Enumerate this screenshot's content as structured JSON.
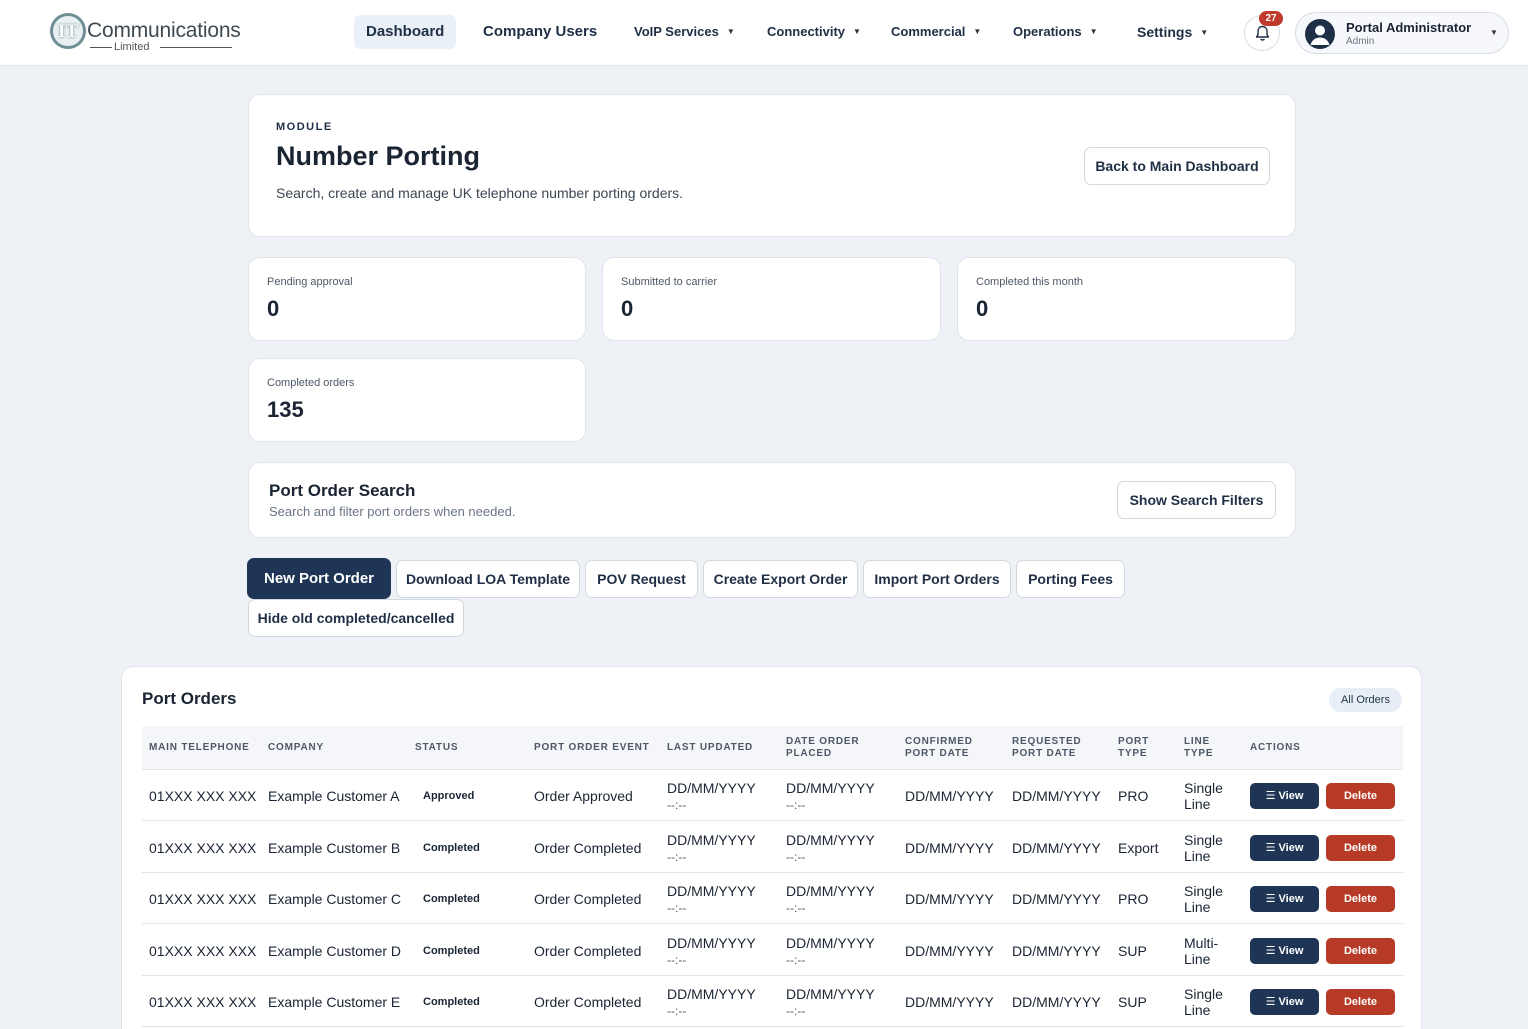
{
  "brand": {
    "name": "Communications",
    "sub": "Limited",
    "initials": "IT"
  },
  "nav": {
    "dashboard": "Dashboard",
    "company_users": "Company Users",
    "voip": "VoIP Services",
    "connectivity": "Connectivity",
    "commercial": "Commercial",
    "operations": "Operations",
    "settings": "Settings"
  },
  "notifications": {
    "count": "27"
  },
  "user": {
    "name": "Portal Administrator",
    "role": "Admin"
  },
  "module": {
    "label": "MODULE",
    "title": "Number Porting",
    "description": "Search, create and manage UK telephone number porting orders.",
    "back_button": "Back to Main Dashboard"
  },
  "stats": [
    {
      "label": "Pending approval",
      "value": "0"
    },
    {
      "label": "Submitted to carrier",
      "value": "0"
    },
    {
      "label": "Completed this month",
      "value": "0"
    },
    {
      "label": "Completed orders",
      "value": "135"
    }
  ],
  "search": {
    "title": "Port Order Search",
    "subtitle": "Search and filter port orders when needed.",
    "toggle_button": "Show Search Filters"
  },
  "actions": {
    "new_port_order": "New Port Order",
    "download_loa": "Download LOA Template",
    "pov_request": "POV Request",
    "create_export": "Create Export Order",
    "import_orders": "Import Port Orders",
    "porting_fees": "Porting Fees",
    "hide_old": "Hide old completed/cancelled"
  },
  "orders": {
    "title": "Port Orders",
    "filter_pill": "All Orders",
    "columns": {
      "main_telephone": "MAIN TELEPHONE",
      "company": "COMPANY",
      "status": "STATUS",
      "event": "PORT ORDER EVENT",
      "last_updated": "LAST UPDATED",
      "date_placed_1": "DATE ORDER",
      "date_placed_2": "PLACED",
      "confirmed_1": "CONFIRMED",
      "confirmed_2": "PORT DATE",
      "requested_1": "REQUESTED",
      "requested_2": "PORT DATE",
      "port_type_1": "PORT",
      "port_type_2": "TYPE",
      "line_type_1": "LINE",
      "line_type_2": "TYPE",
      "actions": "ACTIONS"
    },
    "view_label": "View",
    "delete_label": "Delete",
    "rows": [
      {
        "phone": "01XXX XXX XXX",
        "company": "Example Customer A",
        "status": "Approved",
        "event": "Order Approved",
        "updated_date": "DD/MM/YYYY",
        "updated_time": "--:--",
        "placed_date": "DD/MM/YYYY",
        "placed_time": "--:--",
        "confirmed": "DD/MM/YYYY",
        "requested": "DD/MM/YYYY",
        "port_type": "PRO",
        "line_1": "Single",
        "line_2": "Line"
      },
      {
        "phone": "01XXX XXX XXX",
        "company": "Example Customer B",
        "status": "Completed",
        "event": "Order Completed",
        "updated_date": "DD/MM/YYYY",
        "updated_time": "--:--",
        "placed_date": "DD/MM/YYYY",
        "placed_time": "--:--",
        "confirmed": "DD/MM/YYYY",
        "requested": "DD/MM/YYYY",
        "port_type": "Export",
        "line_1": "Single",
        "line_2": "Line"
      },
      {
        "phone": "01XXX XXX XXX",
        "company": "Example Customer C",
        "status": "Completed",
        "event": "Order Completed",
        "updated_date": "DD/MM/YYYY",
        "updated_time": "--:--",
        "placed_date": "DD/MM/YYYY",
        "placed_time": "--:--",
        "confirmed": "DD/MM/YYYY",
        "requested": "DD/MM/YYYY",
        "port_type": "PRO",
        "line_1": "Single",
        "line_2": "Line"
      },
      {
        "phone": "01XXX XXX XXX",
        "company": "Example Customer D",
        "status": "Completed",
        "event": "Order Completed",
        "updated_date": "DD/MM/YYYY",
        "updated_time": "--:--",
        "placed_date": "DD/MM/YYYY",
        "placed_time": "--:--",
        "confirmed": "DD/MM/YYYY",
        "requested": "DD/MM/YYYY",
        "port_type": "SUP",
        "line_1": "Multi-",
        "line_2": "Line"
      },
      {
        "phone": "01XXX XXX XXX",
        "company": "Example Customer E",
        "status": "Completed",
        "event": "Order Completed",
        "updated_date": "DD/MM/YYYY",
        "updated_time": "--:--",
        "placed_date": "DD/MM/YYYY",
        "placed_time": "--:--",
        "confirmed": "DD/MM/YYYY",
        "requested": "DD/MM/YYYY",
        "port_type": "SUP",
        "line_1": "Single",
        "line_2": "Line"
      }
    ]
  }
}
